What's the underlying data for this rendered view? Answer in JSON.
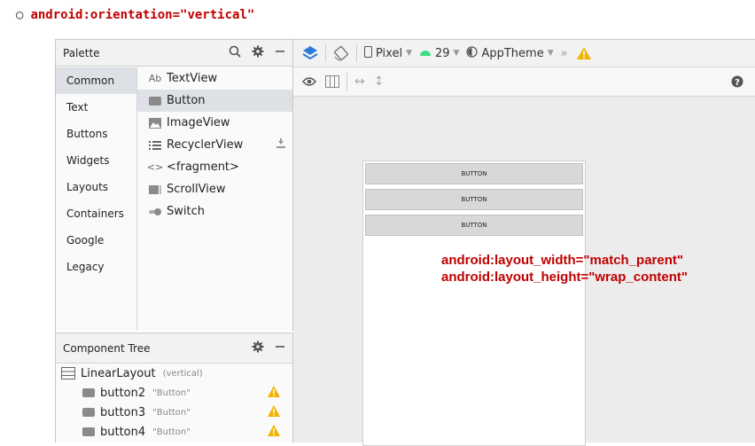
{
  "caption": {
    "bullet": "○",
    "text": "android:orientation=\"vertical\""
  },
  "palette": {
    "title": "Palette",
    "categories": [
      "Common",
      "Text",
      "Buttons",
      "Widgets",
      "Layouts",
      "Containers",
      "Google",
      "Legacy"
    ],
    "selected_category": "Common",
    "items": [
      {
        "label": "TextView",
        "icon": "textview-icon",
        "icon_text": "Ab"
      },
      {
        "label": "Button",
        "icon": "button-icon"
      },
      {
        "label": "ImageView",
        "icon": "imageview-icon"
      },
      {
        "label": "RecyclerView",
        "icon": "recyclerview-icon"
      },
      {
        "label": "<fragment>",
        "icon": "fragment-icon",
        "icon_text": "<>"
      },
      {
        "label": "ScrollView",
        "icon": "scrollview-icon"
      },
      {
        "label": "Switch",
        "icon": "switch-icon"
      }
    ]
  },
  "toolbar": {
    "device": "Pixel",
    "api": "29",
    "theme": "AppTheme",
    "more": "»"
  },
  "canvas": {
    "buttons": [
      "BUTTON",
      "BUTTON",
      "BUTTON"
    ]
  },
  "tree": {
    "title": "Component Tree",
    "root": {
      "label": "LinearLayout",
      "hint": "(vertical)"
    },
    "children": [
      {
        "label": "button2",
        "hint": "\"Button\""
      },
      {
        "label": "button3",
        "hint": "\"Button\""
      },
      {
        "label": "button4",
        "hint": "\"Button\""
      }
    ]
  },
  "annotation": {
    "line1": "android:layout_width=\"match_parent\"",
    "line2": "android:layout_height=\"wrap_content\""
  },
  "colors": {
    "annotation": "#c00000",
    "warning": "#f0b400",
    "selection": "#dde1e6",
    "android_green": "#3ddc84"
  }
}
